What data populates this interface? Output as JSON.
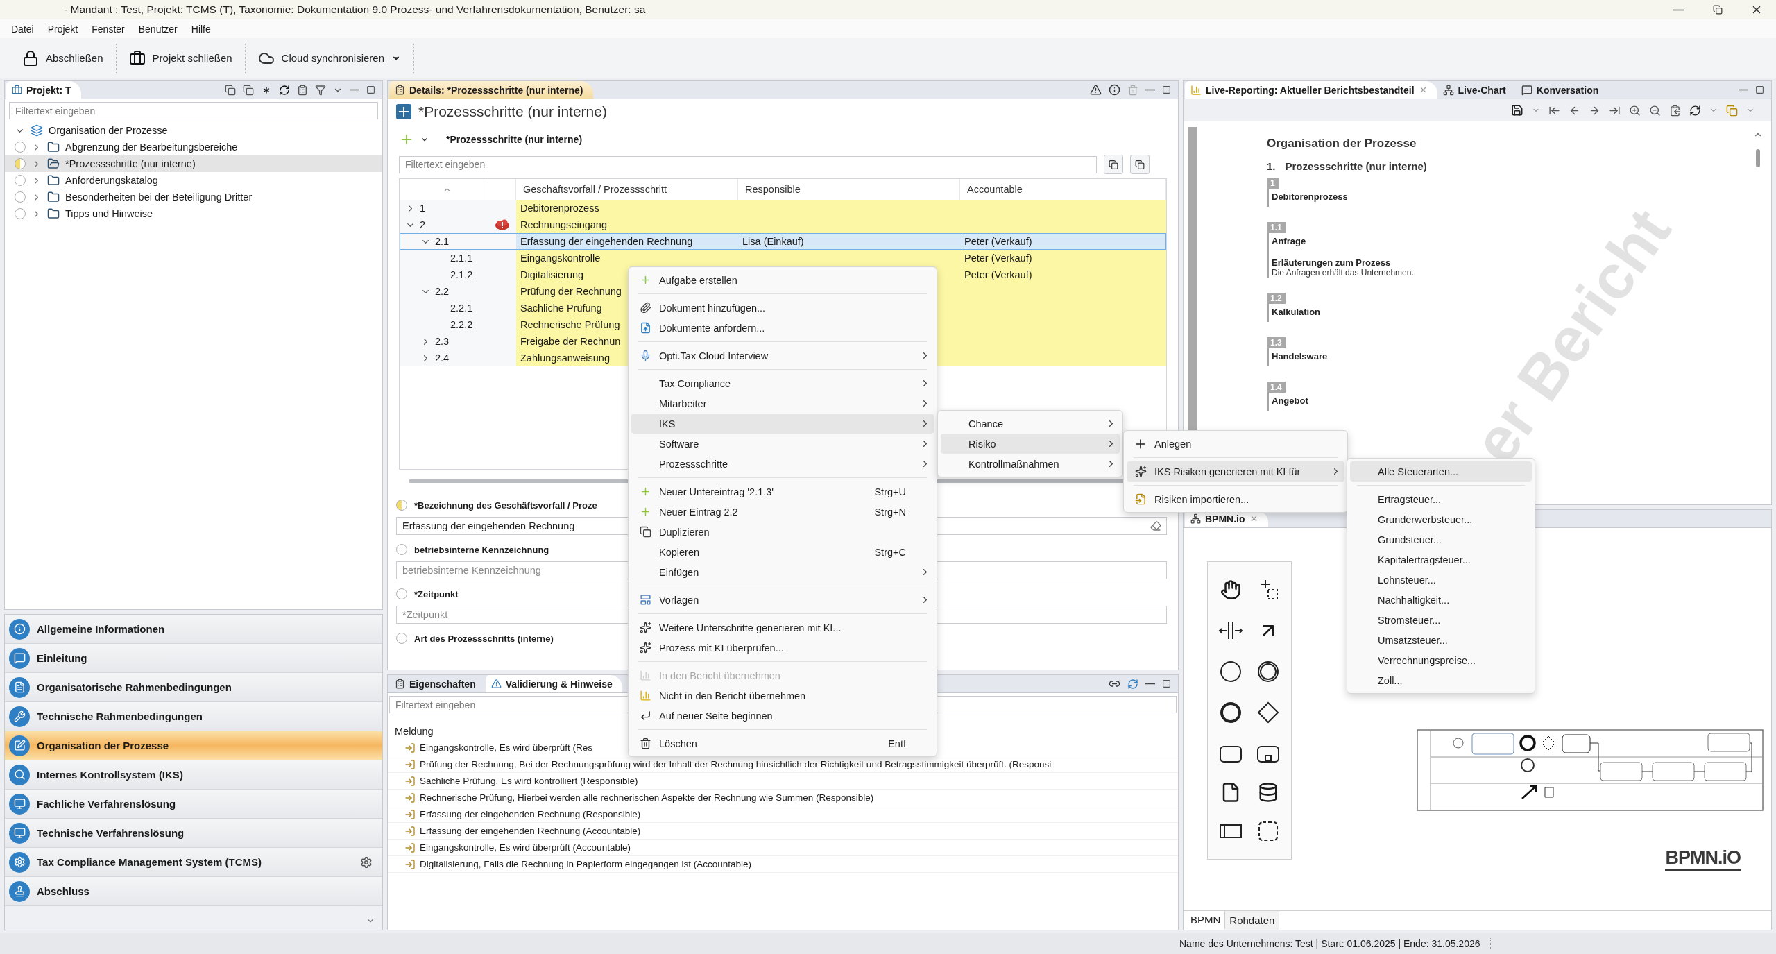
{
  "window": {
    "title": "- Mandant : Test, Projekt: TCMS (T), Taxonomie: Dokumentation 9.0 Prozess- und Verfahrensdokumentation, Benutzer: sa",
    "menu": [
      "Datei",
      "Projekt",
      "Fenster",
      "Benutzer",
      "Hilfe"
    ]
  },
  "toolbar": [
    {
      "label": "Abschließen"
    },
    {
      "label": "Projekt schließen"
    },
    {
      "label": "Cloud synchronisieren",
      "dropdown": true
    }
  ],
  "project_panel": {
    "title": "Projekt: T",
    "filter_placeholder": "Filtertext eingeben",
    "tree": [
      {
        "label": "Organisation der Prozesse",
        "expanded": true,
        "children": [
          {
            "label": "Abgrenzung der Bearbeitungsbereiche",
            "started": false,
            "selected": false
          },
          {
            "label": "*Prozessschritte (nur interne)",
            "started": true,
            "selected": true
          },
          {
            "label": "Anforderungskatalog",
            "started": false,
            "selected": false
          },
          {
            "label": "Besonderheiten bei der Beteiligung Dritter",
            "started": false,
            "selected": false
          },
          {
            "label": "Tipps und Hinweise",
            "started": false,
            "selected": false
          }
        ]
      }
    ]
  },
  "navigation": [
    {
      "label": "Allgemeine Informationen",
      "selected": false
    },
    {
      "label": "Einleitung",
      "selected": false
    },
    {
      "label": "Organisatorische Rahmenbedingungen",
      "selected": false
    },
    {
      "label": "Technische Rahmenbedingungen",
      "selected": false
    },
    {
      "label": "Organisation der Prozesse",
      "selected": true
    },
    {
      "label": "Internes Kontrollsystem (IKS)",
      "selected": false
    },
    {
      "label": "Fachliche Verfahrenslösung",
      "selected": false
    },
    {
      "label": "Technische Verfahrenslösung",
      "selected": false
    },
    {
      "label": "Tax Compliance Management System (TCMS)",
      "selected": false,
      "settings": true
    },
    {
      "label": "Abschluss",
      "selected": false
    }
  ],
  "details": {
    "tab": "Details: *Prozessschritte (nur interne)",
    "heading": "*Prozessschritte (nur interne)",
    "section": "*Prozessschritte (nur interne)",
    "filter_placeholder": "Filtertext eingeben",
    "columns": [
      "Geschäftsvorfall / Prozessschritt",
      "Responsible",
      "Accountable"
    ],
    "rows": [
      {
        "number": "1",
        "title": "Debitorenprozess",
        "expanded": false,
        "selected": false,
        "warning": false
      },
      {
        "number": "2",
        "title": "Rechnungseingang",
        "expanded": true,
        "selected": false,
        "warning": true,
        "children": [
          {
            "number": "2.1",
            "title": "Erfassung der eingehenden Rechnung",
            "responsible": "Lisa (Einkauf)",
            "accountable": "Peter (Verkauf)",
            "expanded": true,
            "selected": true,
            "warning": false,
            "children": [
              {
                "number": "2.1.1",
                "title": "Eingangskontrolle",
                "accountable": "Peter (Verkauf)",
                "selected": false,
                "warning": false
              },
              {
                "number": "2.1.2",
                "title": "Digitalisierung",
                "accountable": "Peter (Verkauf)",
                "selected": false,
                "warning": false
              }
            ]
          },
          {
            "number": "2.2",
            "title": "Prüfung der Rechnung",
            "expanded": true,
            "selected": false,
            "warning": false,
            "children": [
              {
                "number": "2.2.1",
                "title": "Sachliche Prüfung",
                "selected": false,
                "warning": false
              },
              {
                "number": "2.2.2",
                "title": "Rechnerische Prüfung",
                "selected": false,
                "warning": false
              }
            ]
          },
          {
            "number": "2.3",
            "title": "Freigabe der Rechnun",
            "expanded": false,
            "selected": false,
            "warning": false
          },
          {
            "number": "2.4",
            "title": "Zahlungsanweisung",
            "expanded": false,
            "selected": false,
            "warning": false
          }
        ]
      }
    ],
    "form": [
      {
        "label": "*Bezeichnung des Geschäftsvorfall / Proze",
        "started": true,
        "value": "Erfassung der eingehenden Rechnung"
      },
      {
        "label": "betriebsinterne Kennzeichnung",
        "started": false,
        "placeholder": "betriebsinterne Kennzeichnung"
      },
      {
        "label": "*Zeitpunkt",
        "started": false,
        "placeholder": "*Zeitpunkt"
      },
      {
        "label": "Art des Prozessschritts (interne)",
        "started": false
      }
    ]
  },
  "messages_panel": {
    "tabs": [
      {
        "label": "Eigenschaften",
        "selected": false
      },
      {
        "label": "Validierung & Hinweise",
        "selected": true
      }
    ],
    "filter_placeholder": "Filtertext eingeben",
    "column": "Meldung",
    "rows": [
      "Eingangskontrolle, Es wird überprüft (Res",
      "Prüfung der Rechnung, Bei der Rechnungsprüfung wird der Inhalt der Rechnung hinsichtlich der Richtigkeit und Betragsstimmigkeit überprüft. (Responsi",
      "Sachliche Prüfung, Es wird kontrolliert (Responsible)",
      "Rechnerische Prüfung, Hierbei werden alle rechnerischen Aspekte der Rechnung wie Summen (Responsible)",
      "Erfassung der eingehenden Rechnung (Responsible)",
      "Erfassung der eingehenden Rechnung (Accountable)",
      "Eingangskontrolle, Es wird überprüft (Accountable)",
      "Digitalisierung, Falls die Rechnung in Papierform eingegangen ist (Accountable)"
    ]
  },
  "report_panel": {
    "tabs": [
      {
        "label": "Live-Reporting: Aktueller Berichtsbestandteil",
        "selected": true
      },
      {
        "label": "Live-Chart",
        "selected": false
      },
      {
        "label": "Konversation",
        "selected": false
      }
    ],
    "document": {
      "heading": "Organisation der Prozesse",
      "section_number": "1.",
      "section_title": "Prozessschritte (nur interne)",
      "watermark": "er Bericht",
      "entries": [
        {
          "number": "1",
          "title": "Debitorenprozess"
        },
        {
          "number": "1.1",
          "title": "Anfrage",
          "note_title": "Erläuterungen zum Prozess",
          "note": "Die Anfragen erhält das Unternehmen.."
        },
        {
          "number": "1.2",
          "title": "Kalkulation"
        },
        {
          "number": "1.3",
          "title": "Handelsware"
        },
        {
          "number": "1.4",
          "title": "Angebot"
        }
      ]
    }
  },
  "bpmn_panel": {
    "tab": "BPMN.io",
    "logo": "BPMN.iO",
    "tabs": [
      {
        "label": "BPMN",
        "selected": true
      },
      {
        "label": "Rohdaten",
        "selected": false
      }
    ]
  },
  "status_bar": "Name des Unternehmens: Test | Start: 01.06.2025 | Ende: 31.05.2026",
  "context_menu": {
    "items": [
      {
        "kind": "item",
        "label": "Aufgabe erstellen",
        "submenu": false,
        "disabled": false,
        "selected": false
      },
      {
        "kind": "separator"
      },
      {
        "kind": "item",
        "label": "Dokument hinzufügen...",
        "submenu": false,
        "disabled": false,
        "selected": false
      },
      {
        "kind": "item",
        "label": "Dokumente anfordern...",
        "submenu": false,
        "disabled": false,
        "selected": false
      },
      {
        "kind": "separator"
      },
      {
        "kind": "item",
        "label": "Opti.Tax Cloud Interview",
        "submenu": true,
        "disabled": false,
        "selected": false
      },
      {
        "kind": "separator"
      },
      {
        "kind": "item",
        "label": "Tax Compliance",
        "submenu": true,
        "disabled": false,
        "selected": false
      },
      {
        "kind": "item",
        "label": "Mitarbeiter",
        "submenu": true,
        "disabled": false,
        "selected": false
      },
      {
        "kind": "item",
        "label": "IKS",
        "submenu": true,
        "disabled": false,
        "selected": true
      },
      {
        "kind": "item",
        "label": "Software",
        "submenu": true,
        "disabled": false,
        "selected": false
      },
      {
        "kind": "item",
        "label": "Prozessschritte",
        "submenu": true,
        "disabled": false,
        "selected": false
      },
      {
        "kind": "separator"
      },
      {
        "kind": "item",
        "label": "Neuer Untereintrag '2.1.3'",
        "shortcut": "Strg+U",
        "submenu": false,
        "disabled": false,
        "selected": false
      },
      {
        "kind": "item",
        "label": "Neuer Eintrag 2.2",
        "shortcut": "Strg+N",
        "submenu": false,
        "disabled": false,
        "selected": false
      },
      {
        "kind": "item",
        "label": "Duplizieren",
        "submenu": false,
        "disabled": false,
        "selected": false
      },
      {
        "kind": "item",
        "label": "Kopieren",
        "shortcut": "Strg+C",
        "submenu": false,
        "disabled": false,
        "selected": false
      },
      {
        "kind": "item",
        "label": "Einfügen",
        "submenu": true,
        "disabled": false,
        "selected": false
      },
      {
        "kind": "separator"
      },
      {
        "kind": "item",
        "label": "Vorlagen",
        "submenu": true,
        "disabled": false,
        "selected": false
      },
      {
        "kind": "separator"
      },
      {
        "kind": "item",
        "label": "Weitere Unterschritte generieren mit KI...",
        "submenu": false,
        "disabled": false,
        "selected": false
      },
      {
        "kind": "item",
        "label": "Prozess mit KI überprüfen...",
        "submenu": false,
        "disabled": false,
        "selected": false
      },
      {
        "kind": "separator"
      },
      {
        "kind": "item",
        "label": "In den Bericht übernehmen",
        "submenu": false,
        "disabled": true,
        "selected": false
      },
      {
        "kind": "item",
        "label": "Nicht in den Bericht übernehmen",
        "submenu": false,
        "disabled": false,
        "selected": false
      },
      {
        "kind": "item",
        "label": "Auf neuer Seite beginnen",
        "submenu": false,
        "disabled": false,
        "selected": false
      },
      {
        "kind": "separator"
      },
      {
        "kind": "item",
        "label": "Löschen",
        "shortcut": "Entf",
        "submenu": false,
        "disabled": false,
        "selected": false
      }
    ]
  },
  "submenu_iks": {
    "items": [
      {
        "kind": "item",
        "label": "Chance",
        "submenu": true,
        "disabled": false,
        "selected": false
      },
      {
        "kind": "item",
        "label": "Risiko",
        "submenu": true,
        "disabled": false,
        "selected": true
      },
      {
        "kind": "item",
        "label": "Kontrollmaßnahmen",
        "submenu": true,
        "disabled": false,
        "selected": false
      }
    ]
  },
  "submenu_risiko": {
    "items": [
      {
        "kind": "item",
        "label": "Anlegen",
        "submenu": false,
        "disabled": false,
        "selected": false
      },
      {
        "kind": "separator"
      },
      {
        "kind": "item",
        "label": "IKS Risiken generieren mit KI für",
        "submenu": true,
        "disabled": false,
        "selected": true
      },
      {
        "kind": "separator"
      },
      {
        "kind": "item",
        "label": "Risiken importieren...",
        "submenu": false,
        "disabled": false,
        "selected": false
      }
    ]
  },
  "submenu_steuerarten": {
    "items": [
      {
        "kind": "item",
        "label": "Alle Steuerarten...",
        "submenu": false,
        "disabled": false,
        "selected": true
      },
      {
        "kind": "separator"
      },
      {
        "kind": "item",
        "label": "Ertragsteuer...",
        "submenu": false,
        "disabled": false,
        "selected": false
      },
      {
        "kind": "item",
        "label": "Grunderwerbsteuer...",
        "submenu": false,
        "disabled": false,
        "selected": false
      },
      {
        "kind": "item",
        "label": "Grundsteuer...",
        "submenu": false,
        "disabled": false,
        "selected": false
      },
      {
        "kind": "item",
        "label": "Kapitalertragsteuer...",
        "submenu": false,
        "disabled": false,
        "selected": false
      },
      {
        "kind": "item",
        "label": "Lohnsteuer...",
        "submenu": false,
        "disabled": false,
        "selected": false
      },
      {
        "kind": "item",
        "label": "Nachhaltigkeit...",
        "submenu": false,
        "disabled": false,
        "selected": false
      },
      {
        "kind": "item",
        "label": "Stromsteuer...",
        "submenu": false,
        "disabled": false,
        "selected": false
      },
      {
        "kind": "item",
        "label": "Umsatzsteuer...",
        "submenu": false,
        "disabled": false,
        "selected": false
      },
      {
        "kind": "item",
        "label": "Verrechnungspreise...",
        "submenu": false,
        "disabled": false,
        "selected": false
      },
      {
        "kind": "item",
        "label": "Zoll...",
        "submenu": false,
        "disabled": false,
        "selected": false
      }
    ]
  }
}
